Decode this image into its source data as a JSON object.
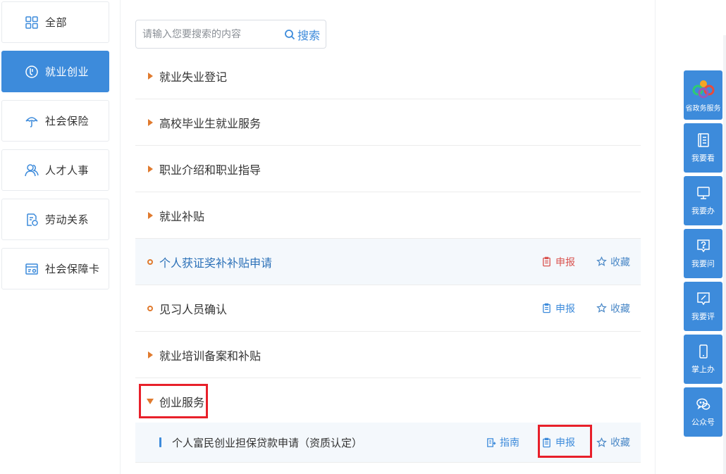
{
  "sidebar": {
    "items": [
      {
        "label": "全部",
        "icon": "grid-icon"
      },
      {
        "label": "就业创业",
        "icon": "employment-icon"
      },
      {
        "label": "社会保险",
        "icon": "umbrella-icon"
      },
      {
        "label": "人才人事",
        "icon": "people-icon"
      },
      {
        "label": "劳动关系",
        "icon": "document-shield-icon"
      },
      {
        "label": "社会保障卡",
        "icon": "card-icon"
      }
    ],
    "active_index": 1
  },
  "search": {
    "placeholder": "请输入您要搜索的内容",
    "button_label": "搜索"
  },
  "list": {
    "rows": [
      {
        "title": "就业失业登记",
        "type": "category-collapsed"
      },
      {
        "title": "高校毕业生就业服务",
        "type": "category-collapsed"
      },
      {
        "title": "职业介绍和职业指导",
        "type": "category-collapsed"
      },
      {
        "title": "就业补贴",
        "type": "category-collapsed"
      },
      {
        "title": "个人获证奖补补贴申请",
        "type": "service",
        "apply": "申报",
        "favorite": "收藏"
      },
      {
        "title": "见习人员确认",
        "type": "service",
        "apply": "申报",
        "favorite": "收藏"
      },
      {
        "title": "就业培训备案和补贴",
        "type": "category-collapsed"
      },
      {
        "title": "创业服务",
        "type": "category-expanded"
      },
      {
        "title": "个人富民创业担保贷款申请（资质认定）",
        "type": "sub-service",
        "guide": "指南",
        "apply": "申报",
        "favorite": "收藏"
      }
    ]
  },
  "float_bar": {
    "items": [
      {
        "label": "省政务服务",
        "icon": "province-logo-icon"
      },
      {
        "label": "我要看",
        "icon": "book-icon"
      },
      {
        "label": "我要办",
        "icon": "monitor-icon"
      },
      {
        "label": "我要问",
        "icon": "question-icon"
      },
      {
        "label": "我要评",
        "icon": "edit-icon"
      },
      {
        "label": "掌上办",
        "icon": "phone-icon"
      },
      {
        "label": "公众号",
        "icon": "wechat-icon"
      }
    ]
  },
  "colors": {
    "accent": "#3d8bdb",
    "marker": "#e07a2e",
    "highlight": "#e8202a"
  }
}
